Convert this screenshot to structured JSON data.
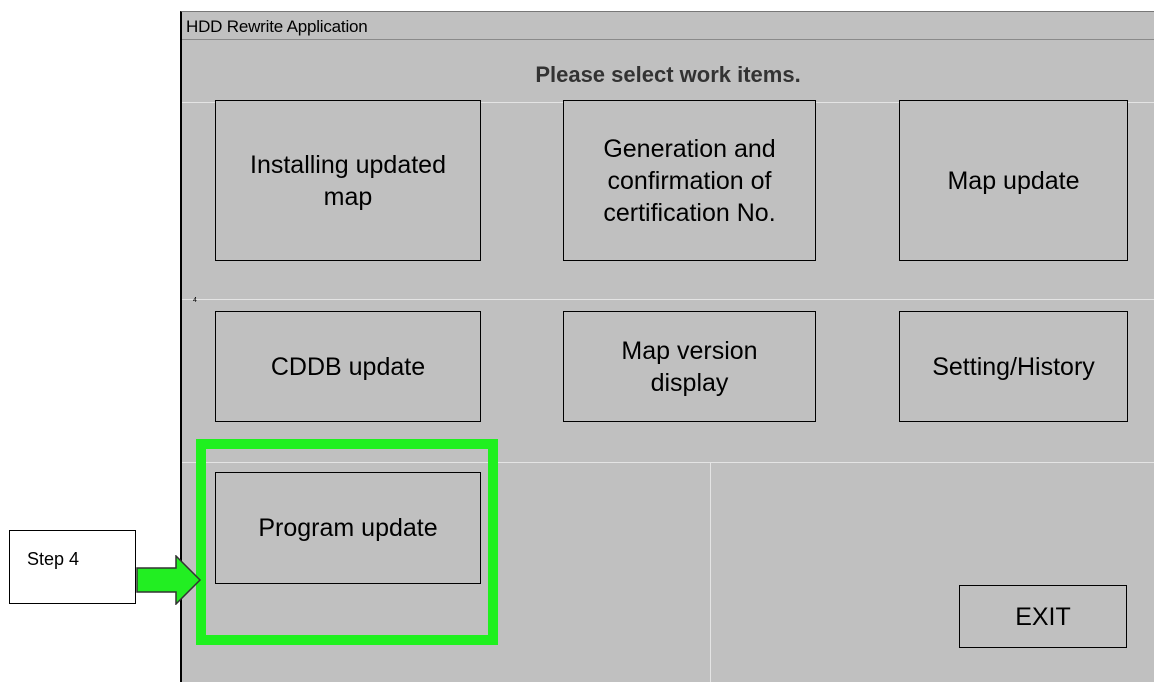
{
  "window": {
    "title": "HDD Rewrite Application"
  },
  "prompt": "Please select work items.",
  "menu": {
    "installing_updated_map": "Installing updated map",
    "generation_certification": "Generation and confirmation of certification No.",
    "map_update": "Map update",
    "cddb_update": "CDDB update",
    "map_version_display": "Map version display",
    "setting_history": "Setting/History",
    "program_update": "Program update",
    "exit": "EXIT"
  },
  "annotation": {
    "step_label": "Step 4",
    "tiny_mark": "4",
    "highlight_color": "#1ff01f",
    "arrow_color": "#22ee22"
  },
  "colors": {
    "window_background": "#c0c0c0"
  }
}
